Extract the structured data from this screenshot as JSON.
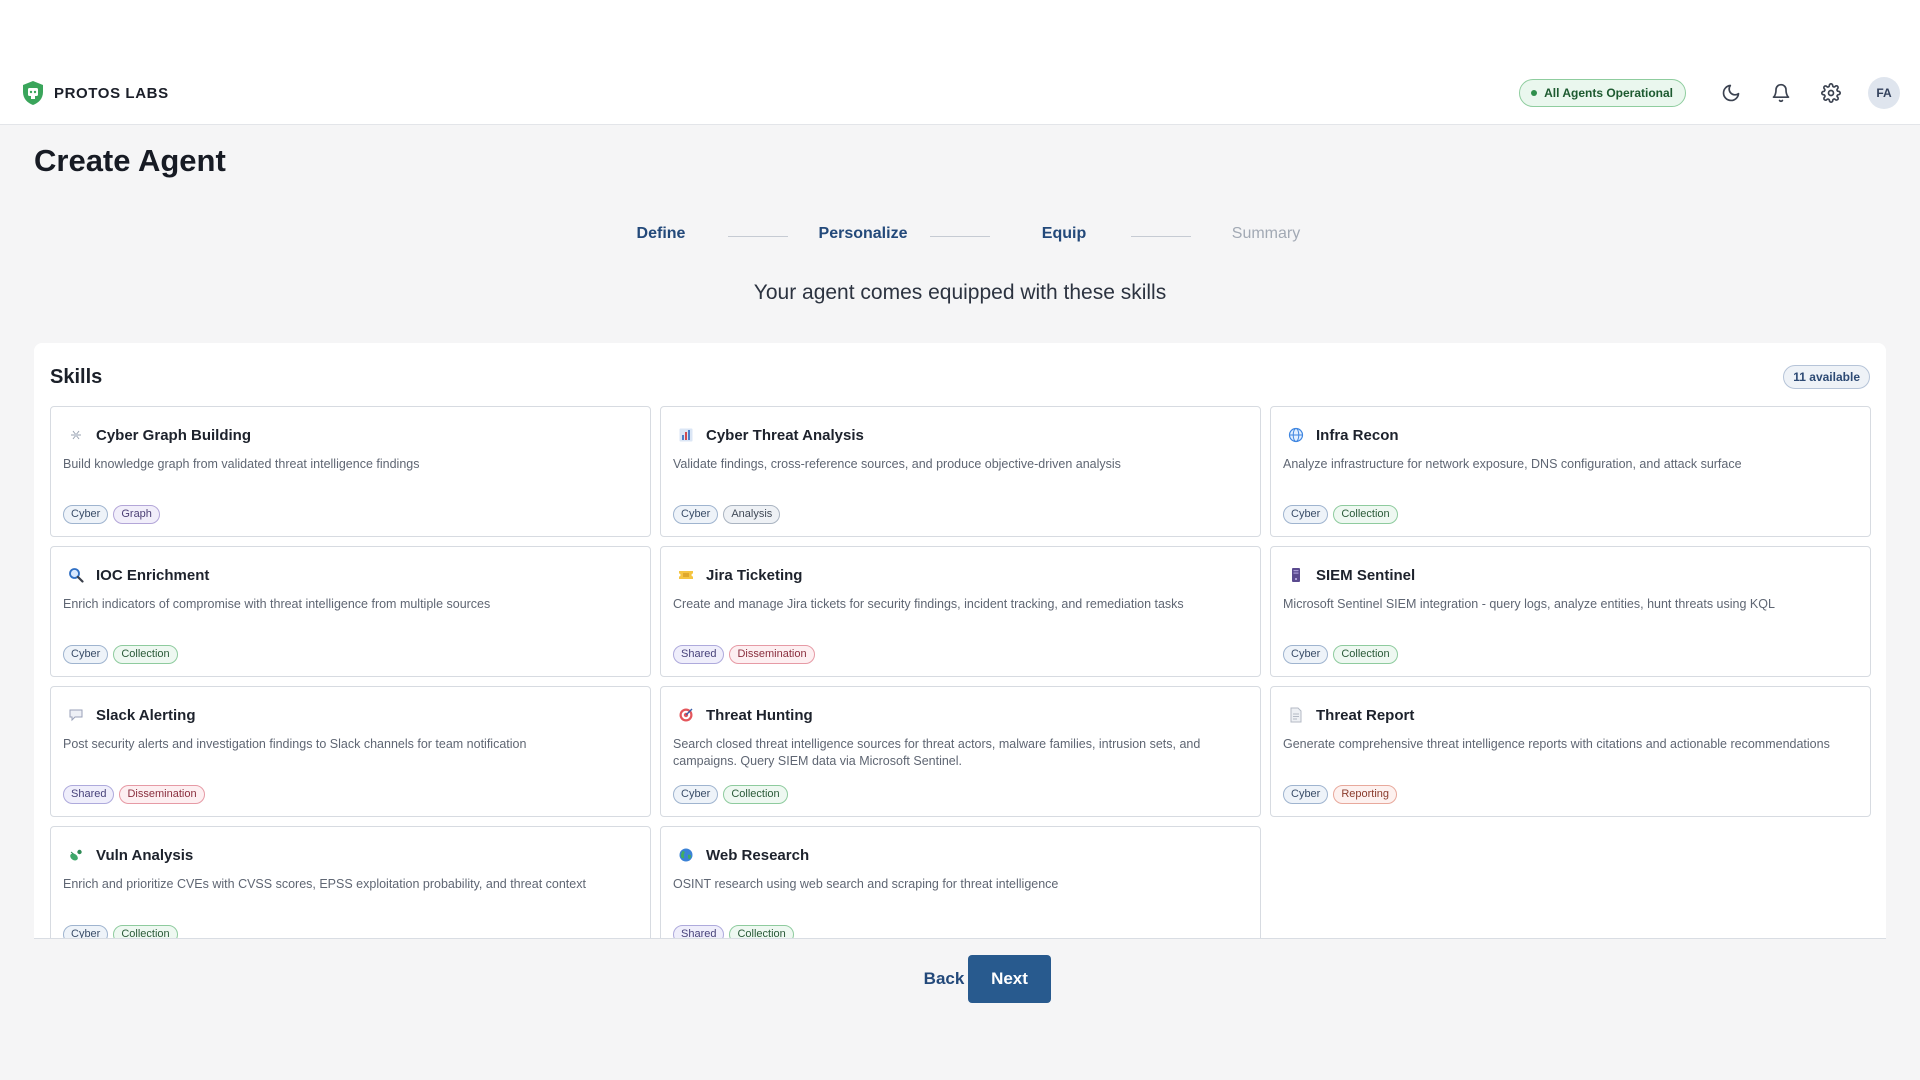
{
  "brand": {
    "name": "PROTOS LABS",
    "color": "#3aa55b"
  },
  "header": {
    "status": "All Agents Operational",
    "status_color": "#2f8f4c",
    "icons": [
      "moon-icon",
      "bell-icon",
      "gear-icon"
    ],
    "avatar_initials": "FA"
  },
  "page": {
    "title": "Create Agent",
    "subtitle": "Your agent comes equipped with these skills"
  },
  "stepper": {
    "steps": [
      {
        "label": "Define",
        "state": "complete"
      },
      {
        "label": "Personalize",
        "state": "complete"
      },
      {
        "label": "Equip",
        "state": "active"
      },
      {
        "label": "Summary",
        "state": "pending"
      }
    ]
  },
  "skills": {
    "title": "Skills",
    "available": "11 available",
    "items": [
      {
        "name": "Cyber Graph Building",
        "icon": "graph-network-icon",
        "description": "Build knowledge graph from validated threat intelligence findings",
        "tags": [
          {
            "label": "Cyber",
            "kind": "cyber"
          },
          {
            "label": "Graph",
            "kind": "graph"
          }
        ]
      },
      {
        "name": "Cyber Threat Analysis",
        "icon": "bar-chart-icon",
        "description": "Validate findings, cross-reference sources, and produce objective-driven analysis",
        "tags": [
          {
            "label": "Cyber",
            "kind": "cyber"
          },
          {
            "label": "Analysis",
            "kind": "analysis"
          }
        ]
      },
      {
        "name": "Infra Recon",
        "icon": "globe-icon",
        "description": "Analyze infrastructure for network exposure, DNS configuration, and attack surface",
        "tags": [
          {
            "label": "Cyber",
            "kind": "cyber"
          },
          {
            "label": "Collection",
            "kind": "collection"
          }
        ]
      },
      {
        "name": "IOC Enrichment",
        "icon": "magnifier-icon",
        "description": "Enrich indicators of compromise with threat intelligence from multiple sources",
        "tags": [
          {
            "label": "Cyber",
            "kind": "cyber"
          },
          {
            "label": "Collection",
            "kind": "collection"
          }
        ]
      },
      {
        "name": "Jira Ticketing",
        "icon": "ticket-icon",
        "description": "Create and manage Jira tickets for security findings, incident tracking, and remediation tasks",
        "tags": [
          {
            "label": "Shared",
            "kind": "shared"
          },
          {
            "label": "Dissemination",
            "kind": "dissemination"
          }
        ]
      },
      {
        "name": "SIEM Sentinel",
        "icon": "server-icon",
        "description": "Microsoft Sentinel SIEM integration - query logs, analyze entities, hunt threats using KQL",
        "tags": [
          {
            "label": "Cyber",
            "kind": "cyber"
          },
          {
            "label": "Collection",
            "kind": "collection"
          }
        ]
      },
      {
        "name": "Slack Alerting",
        "icon": "speech-bubble-icon",
        "description": "Post security alerts and investigation findings to Slack channels for team notification",
        "tags": [
          {
            "label": "Shared",
            "kind": "shared"
          },
          {
            "label": "Dissemination",
            "kind": "dissemination"
          }
        ]
      },
      {
        "name": "Threat Hunting",
        "icon": "target-icon",
        "description": "Search closed threat intelligence sources for threat actors, malware families, intrusion sets, and campaigns. Query SIEM data via Microsoft Sentinel.",
        "tags": [
          {
            "label": "Cyber",
            "kind": "cyber"
          },
          {
            "label": "Collection",
            "kind": "collection"
          }
        ]
      },
      {
        "name": "Threat Report",
        "icon": "document-icon",
        "description": "Generate comprehensive threat intelligence reports with citations and actionable recommendations",
        "tags": [
          {
            "label": "Cyber",
            "kind": "cyber"
          },
          {
            "label": "Reporting",
            "kind": "reporting"
          }
        ]
      },
      {
        "name": "Vuln Analysis",
        "icon": "bug-icon",
        "description": "Enrich and prioritize CVEs with CVSS scores, EPSS exploitation probability, and threat context",
        "tags": [
          {
            "label": "Cyber",
            "kind": "cyber"
          },
          {
            "label": "Collection",
            "kind": "collection"
          }
        ]
      },
      {
        "name": "Web Research",
        "icon": "earth-icon",
        "description": "OSINT research using web search and scraping for threat intelligence",
        "tags": [
          {
            "label": "Shared",
            "kind": "shared"
          },
          {
            "label": "Collection",
            "kind": "collection"
          }
        ]
      }
    ]
  },
  "footer": {
    "back_label": "Back",
    "next_label": "Next",
    "accent": "#285a8e"
  }
}
